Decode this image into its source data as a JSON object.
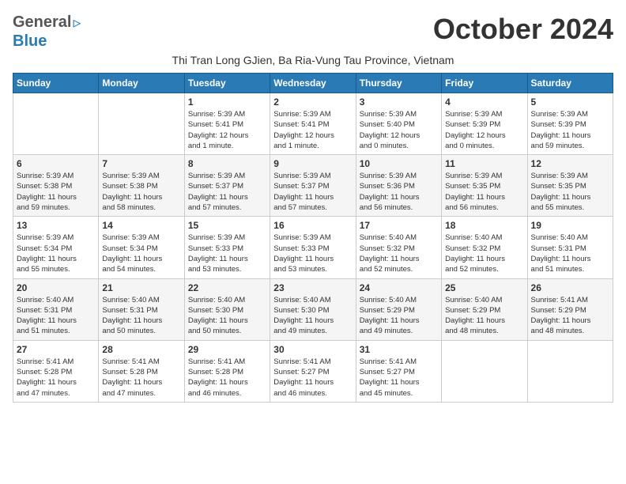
{
  "header": {
    "logo_general": "General",
    "logo_blue": "Blue",
    "month_title": "October 2024",
    "subtitle": "Thi Tran Long GJien, Ba Ria-Vung Tau Province, Vietnam"
  },
  "weekdays": [
    "Sunday",
    "Monday",
    "Tuesday",
    "Wednesday",
    "Thursday",
    "Friday",
    "Saturday"
  ],
  "weeks": [
    [
      {
        "day": "",
        "info": ""
      },
      {
        "day": "",
        "info": ""
      },
      {
        "day": "1",
        "info": "Sunrise: 5:39 AM\nSunset: 5:41 PM\nDaylight: 12 hours\nand 1 minute."
      },
      {
        "day": "2",
        "info": "Sunrise: 5:39 AM\nSunset: 5:41 PM\nDaylight: 12 hours\nand 1 minute."
      },
      {
        "day": "3",
        "info": "Sunrise: 5:39 AM\nSunset: 5:40 PM\nDaylight: 12 hours\nand 0 minutes."
      },
      {
        "day": "4",
        "info": "Sunrise: 5:39 AM\nSunset: 5:39 PM\nDaylight: 12 hours\nand 0 minutes."
      },
      {
        "day": "5",
        "info": "Sunrise: 5:39 AM\nSunset: 5:39 PM\nDaylight: 11 hours\nand 59 minutes."
      }
    ],
    [
      {
        "day": "6",
        "info": "Sunrise: 5:39 AM\nSunset: 5:38 PM\nDaylight: 11 hours\nand 59 minutes."
      },
      {
        "day": "7",
        "info": "Sunrise: 5:39 AM\nSunset: 5:38 PM\nDaylight: 11 hours\nand 58 minutes."
      },
      {
        "day": "8",
        "info": "Sunrise: 5:39 AM\nSunset: 5:37 PM\nDaylight: 11 hours\nand 57 minutes."
      },
      {
        "day": "9",
        "info": "Sunrise: 5:39 AM\nSunset: 5:37 PM\nDaylight: 11 hours\nand 57 minutes."
      },
      {
        "day": "10",
        "info": "Sunrise: 5:39 AM\nSunset: 5:36 PM\nDaylight: 11 hours\nand 56 minutes."
      },
      {
        "day": "11",
        "info": "Sunrise: 5:39 AM\nSunset: 5:35 PM\nDaylight: 11 hours\nand 56 minutes."
      },
      {
        "day": "12",
        "info": "Sunrise: 5:39 AM\nSunset: 5:35 PM\nDaylight: 11 hours\nand 55 minutes."
      }
    ],
    [
      {
        "day": "13",
        "info": "Sunrise: 5:39 AM\nSunset: 5:34 PM\nDaylight: 11 hours\nand 55 minutes."
      },
      {
        "day": "14",
        "info": "Sunrise: 5:39 AM\nSunset: 5:34 PM\nDaylight: 11 hours\nand 54 minutes."
      },
      {
        "day": "15",
        "info": "Sunrise: 5:39 AM\nSunset: 5:33 PM\nDaylight: 11 hours\nand 53 minutes."
      },
      {
        "day": "16",
        "info": "Sunrise: 5:39 AM\nSunset: 5:33 PM\nDaylight: 11 hours\nand 53 minutes."
      },
      {
        "day": "17",
        "info": "Sunrise: 5:40 AM\nSunset: 5:32 PM\nDaylight: 11 hours\nand 52 minutes."
      },
      {
        "day": "18",
        "info": "Sunrise: 5:40 AM\nSunset: 5:32 PM\nDaylight: 11 hours\nand 52 minutes."
      },
      {
        "day": "19",
        "info": "Sunrise: 5:40 AM\nSunset: 5:31 PM\nDaylight: 11 hours\nand 51 minutes."
      }
    ],
    [
      {
        "day": "20",
        "info": "Sunrise: 5:40 AM\nSunset: 5:31 PM\nDaylight: 11 hours\nand 51 minutes."
      },
      {
        "day": "21",
        "info": "Sunrise: 5:40 AM\nSunset: 5:31 PM\nDaylight: 11 hours\nand 50 minutes."
      },
      {
        "day": "22",
        "info": "Sunrise: 5:40 AM\nSunset: 5:30 PM\nDaylight: 11 hours\nand 50 minutes."
      },
      {
        "day": "23",
        "info": "Sunrise: 5:40 AM\nSunset: 5:30 PM\nDaylight: 11 hours\nand 49 minutes."
      },
      {
        "day": "24",
        "info": "Sunrise: 5:40 AM\nSunset: 5:29 PM\nDaylight: 11 hours\nand 49 minutes."
      },
      {
        "day": "25",
        "info": "Sunrise: 5:40 AM\nSunset: 5:29 PM\nDaylight: 11 hours\nand 48 minutes."
      },
      {
        "day": "26",
        "info": "Sunrise: 5:41 AM\nSunset: 5:29 PM\nDaylight: 11 hours\nand 48 minutes."
      }
    ],
    [
      {
        "day": "27",
        "info": "Sunrise: 5:41 AM\nSunset: 5:28 PM\nDaylight: 11 hours\nand 47 minutes."
      },
      {
        "day": "28",
        "info": "Sunrise: 5:41 AM\nSunset: 5:28 PM\nDaylight: 11 hours\nand 47 minutes."
      },
      {
        "day": "29",
        "info": "Sunrise: 5:41 AM\nSunset: 5:28 PM\nDaylight: 11 hours\nand 46 minutes."
      },
      {
        "day": "30",
        "info": "Sunrise: 5:41 AM\nSunset: 5:27 PM\nDaylight: 11 hours\nand 46 minutes."
      },
      {
        "day": "31",
        "info": "Sunrise: 5:41 AM\nSunset: 5:27 PM\nDaylight: 11 hours\nand 45 minutes."
      },
      {
        "day": "",
        "info": ""
      },
      {
        "day": "",
        "info": ""
      }
    ]
  ]
}
